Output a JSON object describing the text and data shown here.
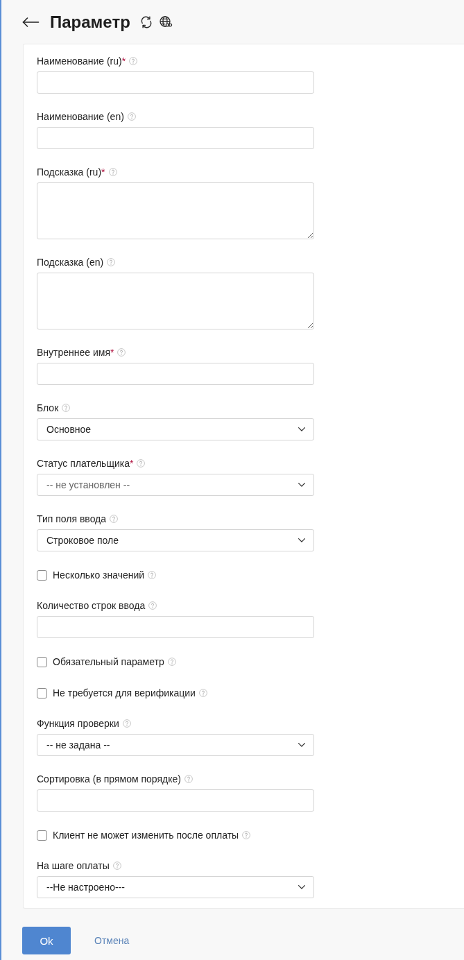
{
  "header": {
    "title": "Параметр"
  },
  "fields": [
    {
      "kind": "text",
      "label": "Наименование (ru)",
      "required_mark": "*"
    },
    {
      "kind": "text",
      "label": "Наименование (en)"
    },
    {
      "kind": "textarea",
      "label": "Подсказка (ru)",
      "required_mark": "*"
    },
    {
      "kind": "textarea",
      "label": "Подсказка (en)"
    },
    {
      "kind": "text",
      "label": "Внутреннее имя",
      "required_mark": "*"
    },
    {
      "kind": "select",
      "label": "Блок",
      "value": "Основное"
    },
    {
      "kind": "select",
      "label": "Статус плательщика",
      "required_mark": "*",
      "placeholder": "-- не установлен --"
    },
    {
      "kind": "select",
      "label": "Тип поля ввода",
      "value": "Строковое поле"
    },
    {
      "kind": "checkbox",
      "label": "Несколько значений",
      "checked": false
    },
    {
      "kind": "text",
      "label": "Количество строк ввода"
    },
    {
      "kind": "checkbox",
      "label": "Обязательный параметр",
      "checked": false
    },
    {
      "kind": "checkbox",
      "label": "Не требуется для верификации",
      "checked": false
    },
    {
      "kind": "select",
      "label": "Функция проверки",
      "value": "-- не задана --"
    },
    {
      "kind": "text",
      "label": "Сортировка (в прямом порядке)"
    },
    {
      "kind": "checkbox",
      "label": "Клиент не может изменить после оплаты",
      "checked": false
    },
    {
      "kind": "select",
      "label": "На шаге оплаты",
      "value": "--Не настроено---"
    }
  ],
  "actions": [
    {
      "kind": "primary",
      "label": "Ok"
    },
    {
      "kind": "link",
      "label": "Отмена"
    }
  ]
}
